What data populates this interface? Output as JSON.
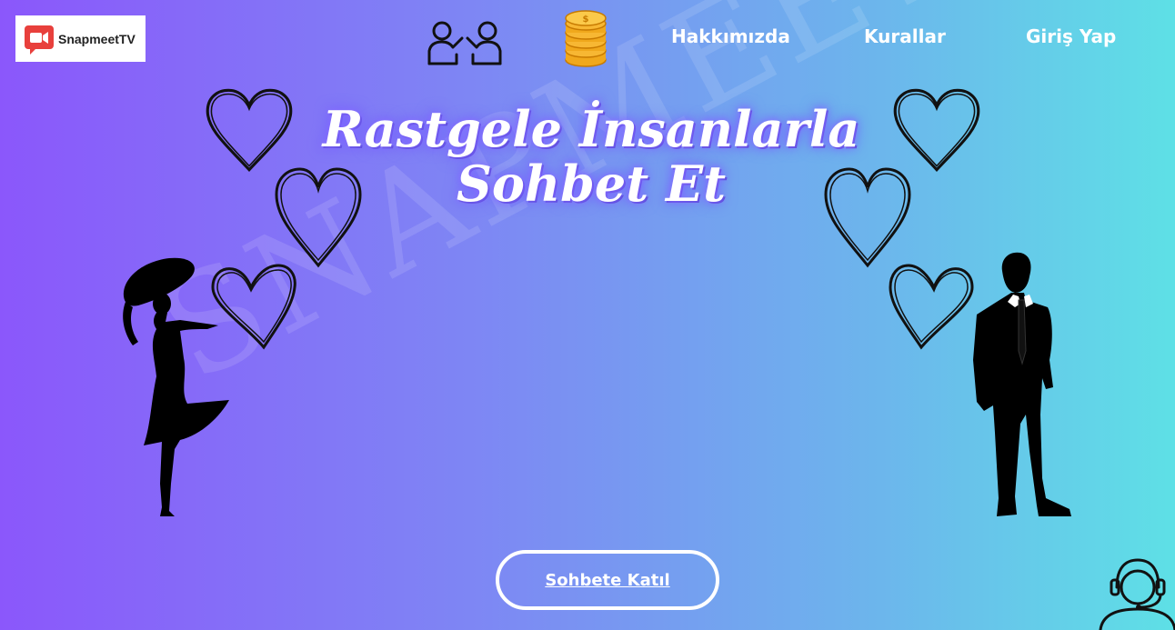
{
  "brand": {
    "name": "SnapmeetTV",
    "accent": "#e8403c"
  },
  "nav": {
    "items": [
      {
        "label": "Hakkımızda"
      },
      {
        "label": "Kurallar"
      },
      {
        "label": "Giriş Yap"
      }
    ],
    "icons": [
      "people-chat-icon",
      "coin-stack-icon"
    ]
  },
  "hero": {
    "title": "Rastgele İnsanlarla Sohbet Et",
    "watermark": "SNAPMEET",
    "cta_label": "Sohbete Katıl"
  },
  "support": {
    "icon": "support-agent-icon"
  },
  "colors": {
    "gradient_start": "#8b57fb",
    "gradient_end": "#5ee0e6"
  }
}
